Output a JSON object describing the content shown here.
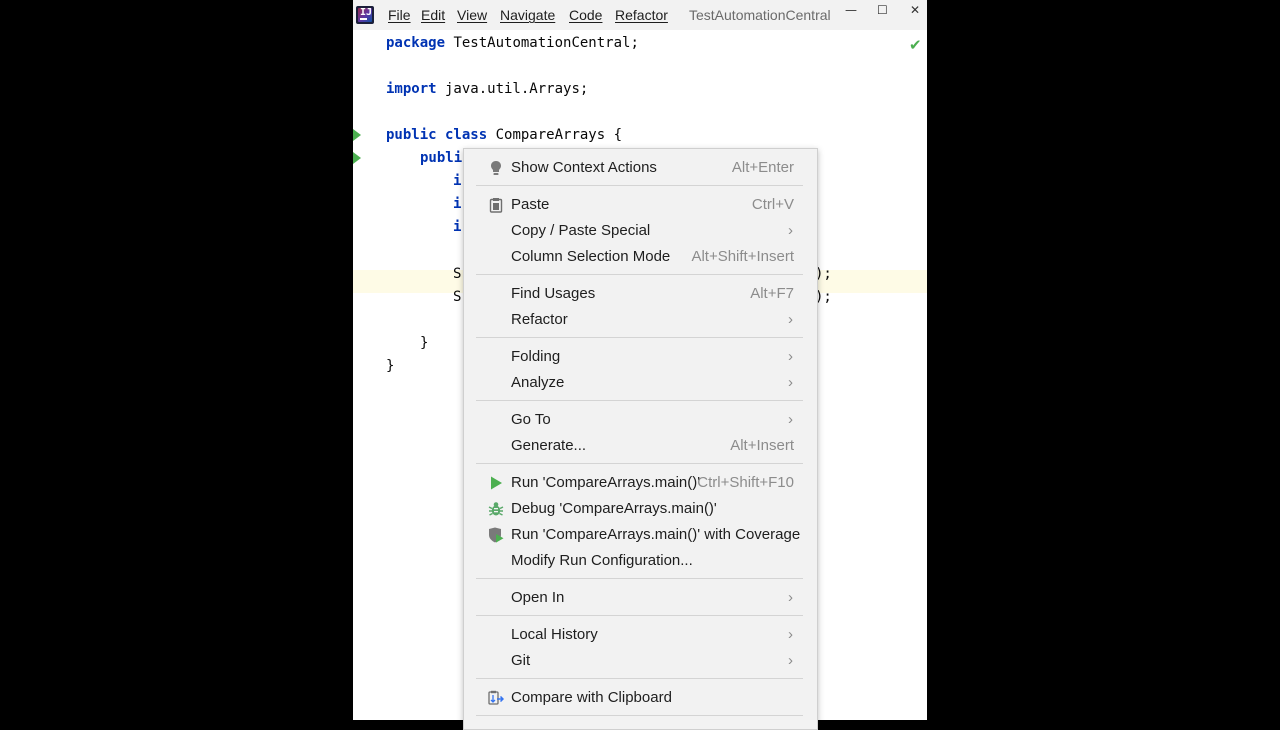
{
  "window": {
    "title": "TestAutomationCentral",
    "logo_text": "IJ",
    "menu": [
      {
        "label": "File"
      },
      {
        "label": "Edit"
      },
      {
        "label": "View"
      },
      {
        "label": "Navigate"
      },
      {
        "label": "Code"
      },
      {
        "label": "Refactor"
      }
    ],
    "controls": {
      "minimize": "—",
      "maximize": "☐",
      "close": "✕"
    }
  },
  "editor": {
    "lines": {
      "l1_kw": "package",
      "l1_rest": " TestAutomationCentral;",
      "l2_kw": "import",
      "l2_rest": " java.util.Arrays;",
      "l3_kw1": "public",
      "l3_kw2": " class",
      "l3_rest": " CompareArrays {",
      "l4": "publi",
      "l5": "i",
      "l6": "i",
      "l7": "i",
      "l8": "S",
      "l8_tail": ");",
      "l9": "S",
      "l9_tail": ");",
      "l10": "}",
      "l11": "}"
    },
    "inspection_icon": "checkmark-icon"
  },
  "context_menu": {
    "items": [
      {
        "label": "Show Context Actions",
        "shortcut": "Alt+Enter",
        "icon": "lightbulb-icon"
      },
      {
        "label": "Paste",
        "shortcut": "Ctrl+V",
        "icon": "clipboard-icon"
      },
      {
        "label": "Copy / Paste Special",
        "submenu": "›"
      },
      {
        "label": "Column Selection Mode",
        "shortcut": "Alt+Shift+Insert"
      },
      {
        "label": "Find Usages",
        "shortcut": "Alt+F7"
      },
      {
        "label": "Refactor",
        "submenu": "›"
      },
      {
        "label": "Folding",
        "submenu": "›"
      },
      {
        "label": "Analyze",
        "submenu": "›"
      },
      {
        "label": "Go To",
        "submenu": "›"
      },
      {
        "label": "Generate...",
        "shortcut": "Alt+Insert"
      },
      {
        "label": "Run 'CompareArrays.main()'",
        "shortcut": "Ctrl+Shift+F10",
        "icon": "run-icon"
      },
      {
        "label": "Debug 'CompareArrays.main()'",
        "icon": "debug-bug-icon"
      },
      {
        "label": "Run 'CompareArrays.main()' with Coverage",
        "icon": "coverage-shield-icon"
      },
      {
        "label": "Modify Run Configuration..."
      },
      {
        "label": "Open In",
        "submenu": "›"
      },
      {
        "label": "Local History",
        "submenu": "›"
      },
      {
        "label": "Git",
        "submenu": "›"
      },
      {
        "label": "Compare with Clipboard",
        "icon": "compare-clipboard-icon"
      }
    ]
  },
  "colors": {
    "keyword": "#0033b3",
    "run_green": "#4caf50",
    "caret_line": "#fefbe6",
    "menu_bg": "#f2f2f2",
    "shortcut_gray": "#8c8c8c"
  }
}
